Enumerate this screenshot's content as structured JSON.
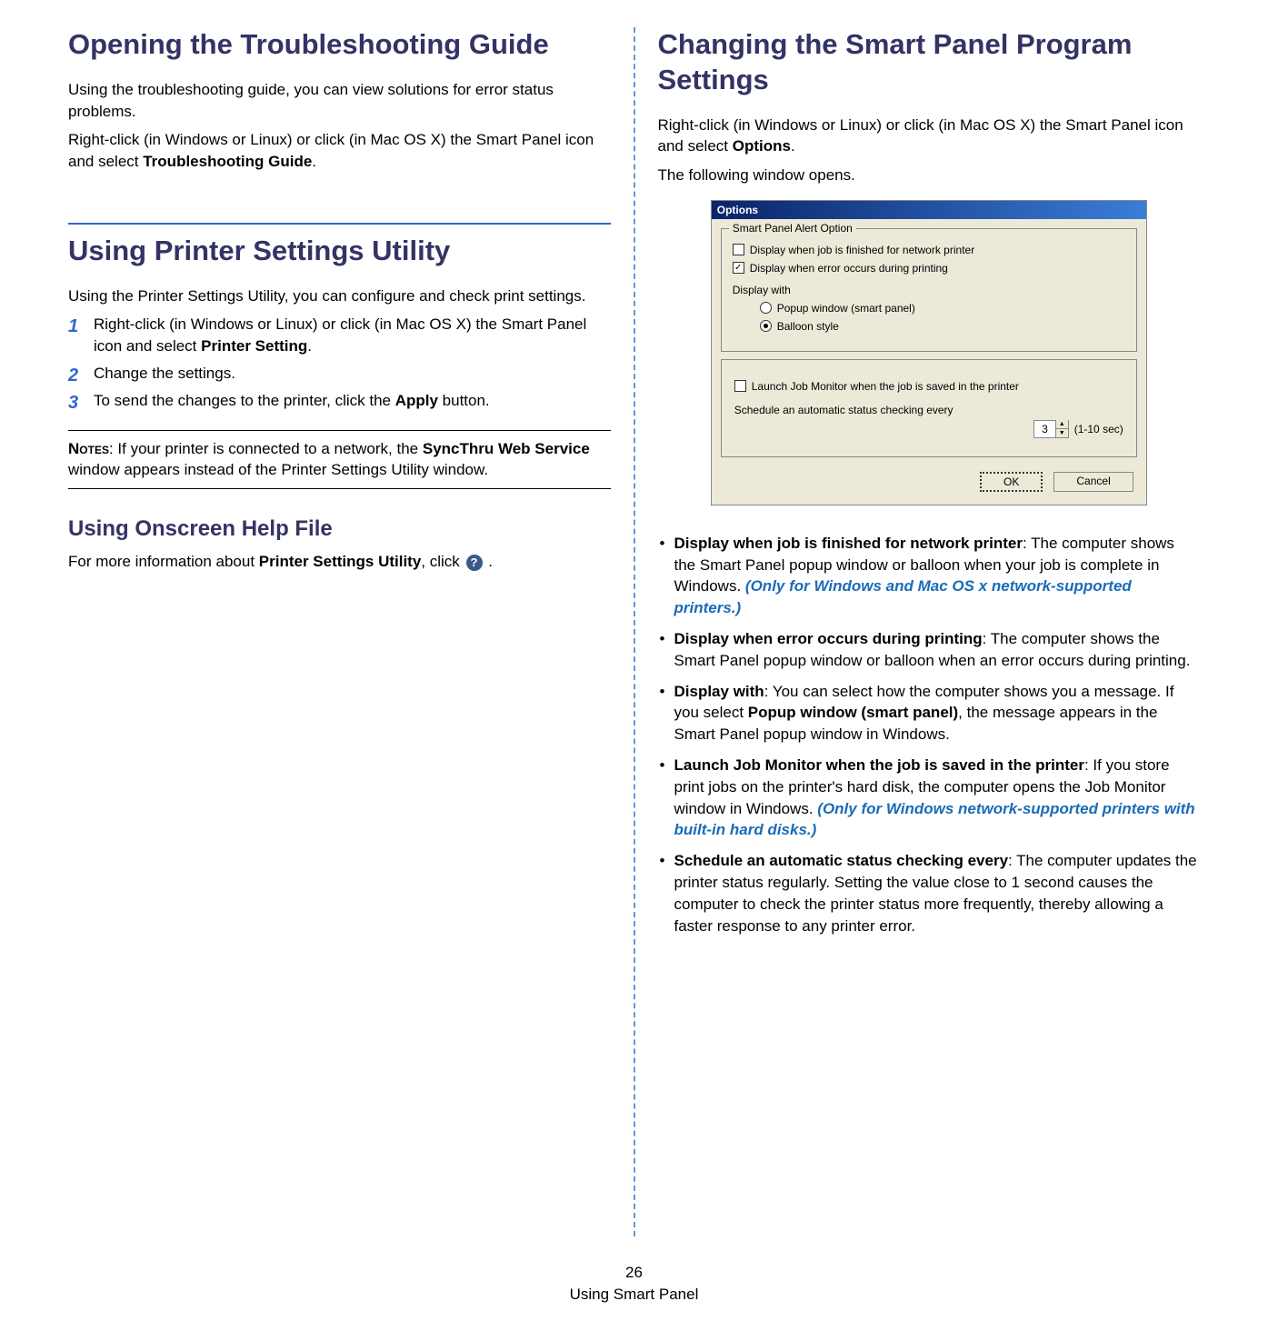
{
  "left": {
    "section1": {
      "heading": "Opening the Troubleshooting Guide",
      "p1": "Using the troubleshooting guide, you can view solutions for error status problems.",
      "p2a": "Right-click (in Windows or Linux) or click (in Mac OS X) the Smart Panel icon and select ",
      "p2b": "Troubleshooting Guide",
      "p2c": "."
    },
    "section2": {
      "heading": "Using Printer Settings Utility",
      "p1": "Using the Printer Settings Utility, you can configure and check print settings.",
      "steps": [
        {
          "n": "1",
          "a": "Right-click (in Windows or Linux) or click (in Mac OS X) the Smart Panel icon and select ",
          "b": "Printer Setting",
          "c": "."
        },
        {
          "n": "2",
          "a": "Change the settings.",
          "b": "",
          "c": ""
        },
        {
          "n": "3",
          "a": "To send the changes to the printer, click the ",
          "b": "Apply",
          "c": " button."
        }
      ],
      "notes_label": "Notes",
      "notes_a": ": If your printer is connected to a network, the ",
      "notes_b": "SyncThru Web Service",
      "notes_c": " window appears instead of the Printer Settings Utility window."
    },
    "section3": {
      "heading": "Using Onscreen Help File",
      "p1a": "For more information about ",
      "p1b": "Printer Settings Utility",
      "p1c": ", click ",
      "p1d": " .",
      "help_icon": "?"
    }
  },
  "right": {
    "heading": "Changing the Smart Panel Program Settings",
    "p1a": "Right-click (in Windows or Linux) or click (in Mac OS X) the Smart Panel icon and select ",
    "p1b": "Options",
    "p1c": ".",
    "p2": "The following window opens.",
    "dialog": {
      "title": "Options",
      "group_label": "Smart Panel Alert Option",
      "cb1": "Display when job is finished for network printer",
      "cb1_checked": false,
      "cb2": "Display when error occurs during printing",
      "cb2_checked": true,
      "display_with_label": "Display with",
      "radio1": "Popup window (smart panel)",
      "radio1_selected": false,
      "radio2": "Balloon style",
      "radio2_selected": true,
      "cb3": "Launch Job Monitor when the job is saved in the printer",
      "cb3_checked": false,
      "schedule_label": "Schedule an automatic status checking every",
      "spinner_value": "3",
      "range": "(1-10 sec)",
      "ok": "OK",
      "cancel": "Cancel"
    },
    "bullets": [
      {
        "bold": "Display when job is finished for network printer",
        "text": ": The computer shows the Smart Panel popup window or balloon when your job is complete in Windows. ",
        "blue": "(Only for Windows and Mac OS x network-supported printers.)"
      },
      {
        "bold": "Display when error occurs during printing",
        "text": ": The computer shows the Smart Panel popup window or balloon when an error occurs during printing.",
        "blue": ""
      },
      {
        "bold": "Display with",
        "text": ": You can select how the computer shows you a message. If you select ",
        "bold2": "Popup window (smart panel)",
        "text2": ", the message appears in the Smart Panel popup window in Windows.",
        "blue": ""
      },
      {
        "bold": "Launch Job Monitor when the job is saved in the printer",
        "text": ": If you store print jobs on the printer's hard disk, the computer opens the Job Monitor window in Windows. ",
        "blue": "(Only for Windows network-supported printers with built-in hard disks.)"
      },
      {
        "bold": "Schedule an automatic status checking every",
        "text": ": The computer updates the printer status regularly. Setting the value close to 1 second causes the computer to check the printer status more frequently, thereby allowing a faster response to any printer error.",
        "blue": ""
      }
    ]
  },
  "footer": {
    "page_num": "26",
    "chapter": "Using Smart Panel"
  }
}
